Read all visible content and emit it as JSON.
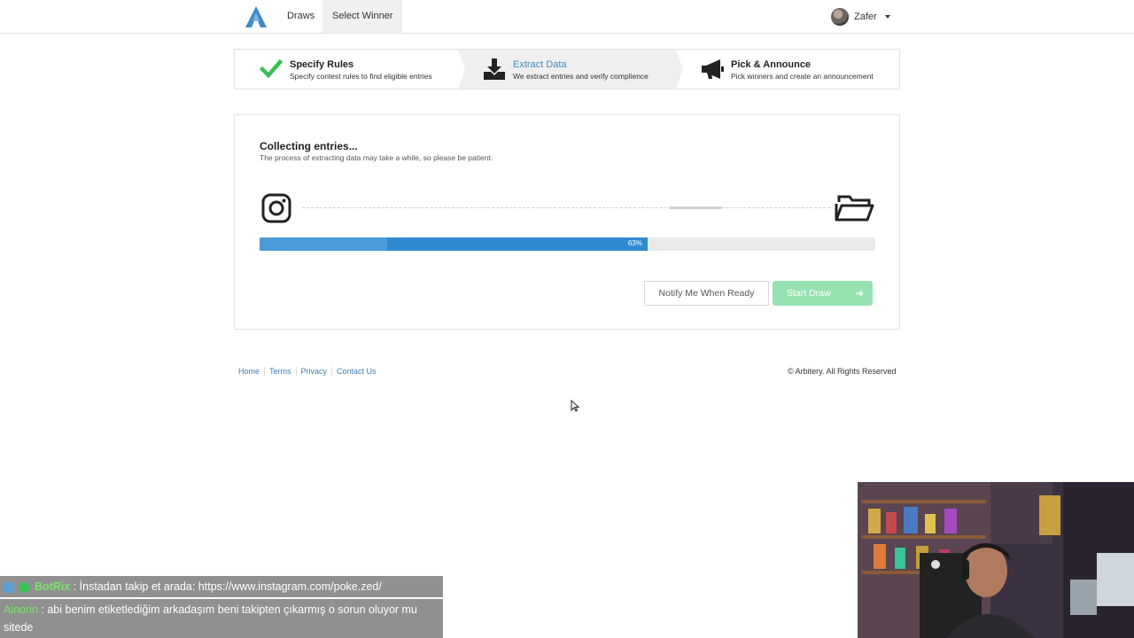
{
  "nav": {
    "draws": "Draws",
    "select_winner": "Select Winner",
    "user_name": "Zafer"
  },
  "steps": [
    {
      "title": "Specify Rules",
      "desc": "Specify contest rules to find eligible entries",
      "icon": "check-icon",
      "state": "done"
    },
    {
      "title": "Extract Data",
      "desc": "We extract entries and verify complience",
      "icon": "download-icon",
      "state": "active"
    },
    {
      "title": "Pick & Announce",
      "desc": "Pick winners and create an announcement",
      "icon": "megaphone-icon",
      "state": "pending"
    }
  ],
  "card": {
    "title": "Collecting entries...",
    "subtitle": "The process of extracting data may take a while, so please be patient.",
    "progress_label": "63%",
    "progress_value": 63,
    "notify_button": "Notify Me When Ready",
    "start_button": "Start Draw"
  },
  "footer": {
    "links": [
      "Home",
      "Terms",
      "Privacy",
      "Contact Us"
    ],
    "copyright": "© Arbitery. All Rights Reserved"
  },
  "chat": [
    {
      "user": "BotRix",
      "message": ": İnstadan takip et arada: https://www.instagram.com/poke.zed/"
    },
    {
      "user": "Ainorin",
      "message": ": abi benim etiketlediğim arkadaşım beni takipten çıkarmış o sorun oluyor mu sitede"
    }
  ],
  "colors": {
    "accent": "#3e8bc5",
    "progress": "#2f8ad1",
    "success": "#35c053",
    "start_button": "#97e2b1"
  }
}
